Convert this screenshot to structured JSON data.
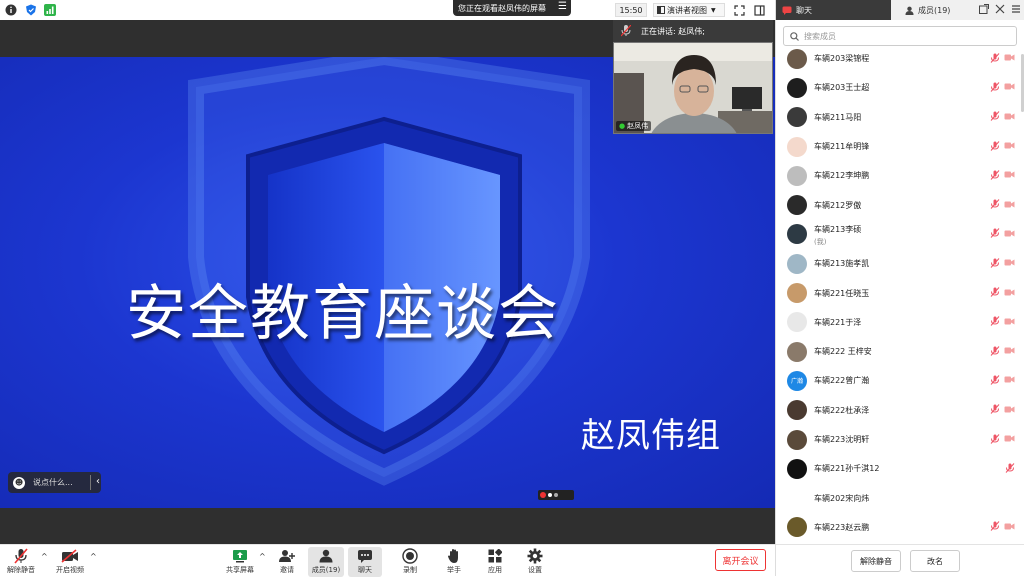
{
  "topbar": {
    "viewing_text": "您正在观看赵凤伟的屏幕",
    "time": "15:50",
    "view_mode": "演讲者视图"
  },
  "speaking": {
    "label": "正在讲话: 赵凤伟;"
  },
  "video": {
    "name": "赵凤伟"
  },
  "slide": {
    "title": "安全教育座谈会",
    "subtitle": "赵凤伟组"
  },
  "chat_input": {
    "placeholder": "说点什么..."
  },
  "toolbar": {
    "unmute": "解除静音",
    "video": "开启视频",
    "share": "共享屏幕",
    "invite": "邀请",
    "members": "成员(19)",
    "chat": "聊天",
    "record": "录制",
    "raise_hand": "举手",
    "apps": "应用",
    "settings": "设置",
    "leave": "离开会议"
  },
  "panel": {
    "tab_chat": "聊天",
    "tab_members": "成员(19)",
    "search_placeholder": "搜索成员",
    "unmute_all": "解除静音",
    "rename": "改名",
    "members": [
      {
        "name": "车辆203梁锦程",
        "avatar_color": "#6b5a4a"
      },
      {
        "name": "车辆203王士超",
        "avatar_color": "#1e1e1e"
      },
      {
        "name": "车辆211马阳",
        "avatar_color": "#3a3a3a"
      },
      {
        "name": "车辆211牟明锋",
        "avatar_color": "#f4d9cc"
      },
      {
        "name": "车辆212李坤鹏",
        "avatar_color": "#bdbdbd"
      },
      {
        "name": "车辆212罗傲",
        "avatar_color": "#2a2a2a"
      },
      {
        "name": "车辆213李硕",
        "avatar_color": "#2d3a44",
        "sub": "(我)"
      },
      {
        "name": "车辆213施孝凯",
        "avatar_color": "#9fb7c6"
      },
      {
        "name": "车辆221任晓玉",
        "avatar_color": "#c79a6a"
      },
      {
        "name": "车辆221于泽",
        "avatar_color": "#e8e8e8"
      },
      {
        "name": "车辆222 王梓安",
        "avatar_color": "#8a7a6a"
      },
      {
        "name": "车辆222曾广瀚",
        "avatar_color": "#1e88e5",
        "initials": "广瀚"
      },
      {
        "name": "车辆222杜承泽",
        "avatar_color": "#4a3a30"
      },
      {
        "name": "车辆223沈明轩",
        "avatar_color": "#5a4a3a"
      },
      {
        "name": "车辆221孙千淇12",
        "avatar_color": "#111111"
      },
      {
        "name": "车辆202宋向炜",
        "avatar_color": "#ffffff"
      },
      {
        "name": "车辆223赵云鹏",
        "avatar_color": "#6a5a2a"
      }
    ]
  }
}
